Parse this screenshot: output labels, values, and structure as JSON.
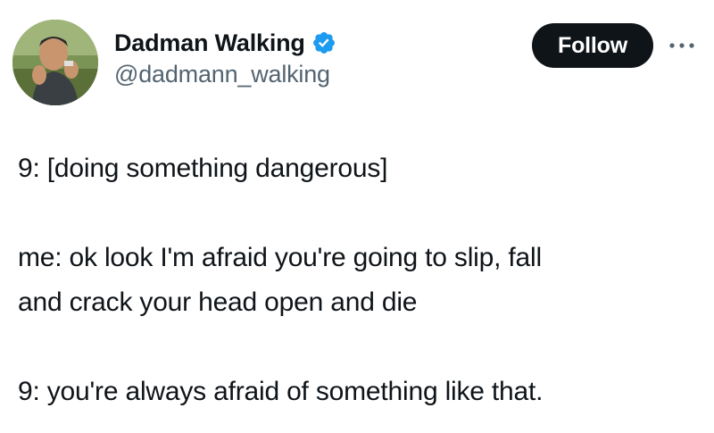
{
  "author": {
    "display_name": "Dadman Walking",
    "handle": "@dadmann_walking",
    "verified_icon": "verified-badge-icon",
    "verified_color": "#1d9bf0"
  },
  "actions": {
    "follow_label": "Follow",
    "more_icon": "more-options-icon"
  },
  "tweet": {
    "lines": [
      "9: [doing something dangerous]",
      "me: ok look I'm afraid you're going to slip, fall",
      "and crack your head open and die",
      "9: you're always afraid of something like that."
    ]
  },
  "colors": {
    "text": "#0f1419",
    "secondary_text": "#536471",
    "follow_bg": "#0f1419",
    "follow_text": "#ffffff"
  }
}
